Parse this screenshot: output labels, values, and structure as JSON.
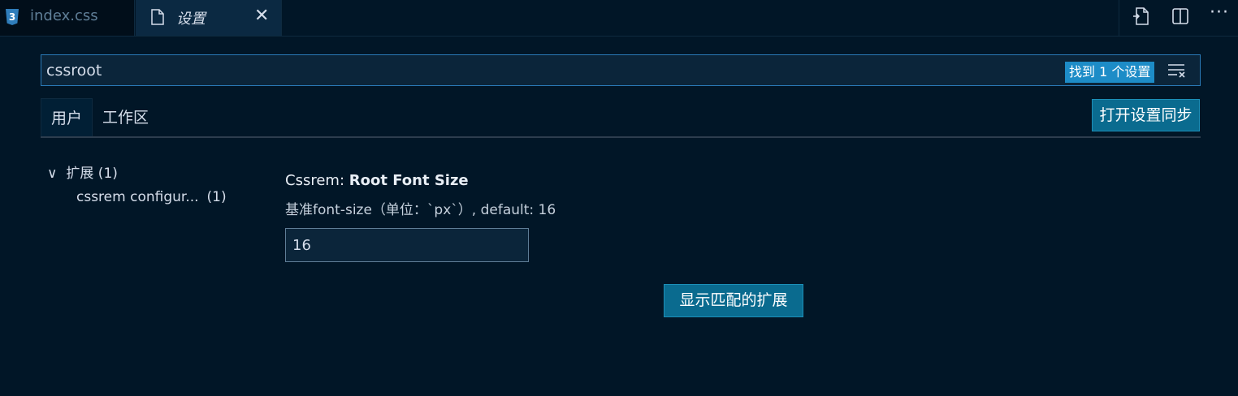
{
  "tabs": [
    {
      "label": "index.css",
      "icon": "css3-icon",
      "icon_glyph": "3",
      "active": false
    },
    {
      "label": "设置",
      "icon": "file-icon",
      "active": true,
      "close_glyph": "✕"
    }
  ],
  "toolbar": {
    "icons": [
      "open-json-icon",
      "split-editor-icon",
      "more-actions-icon"
    ],
    "more_glyph": "···"
  },
  "search": {
    "value": "cssroot",
    "result_badge": "找到 1 个设置",
    "clear_icon": "clear-filter-icon"
  },
  "scope_tabs": {
    "user": "用户",
    "workspace": "工作区",
    "sync_button": "打开设置同步"
  },
  "toc": {
    "group_chevron": "∨",
    "group_label": "扩展 (1)",
    "item_label": "cssrem configur...",
    "item_count": "(1)"
  },
  "setting": {
    "category": "Cssrem: ",
    "name": "Root Font Size",
    "description": "基准font-size（单位：`px`）, default: 16",
    "value": "16"
  },
  "show_extensions_button": "显示匹配的扩展",
  "colors": {
    "background": "#011627",
    "accent": "#1d8cc7",
    "button": "#0a6b8f"
  }
}
